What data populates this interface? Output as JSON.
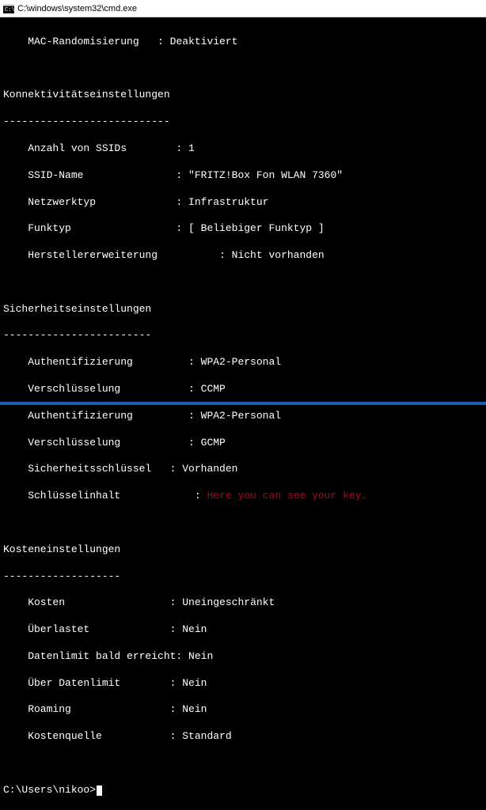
{
  "titlebar": {
    "title": "C:\\windows\\system32\\cmd.exe"
  },
  "top": {
    "macRandLabel": "    MAC-Randomisierung   : ",
    "macRandValue": "Deaktiviert"
  },
  "conn": {
    "header": "Konnektivitätseinstellungen",
    "dashes": "---------------------------",
    "ssidCountLabel": "    Anzahl von SSIDs        : ",
    "ssidCountValue": "1",
    "ssidNameLabel": "    SSID-Name               : ",
    "ssidNameValue": "\"FRITZ!Box Fon WLAN 7360\"",
    "netTypeLabel": "    Netzwerktyp             : ",
    "netTypeValue": "Infrastruktur",
    "radioTypeLabel": "    Funktyp                 : ",
    "radioTypeValue": "[ Beliebiger Funktyp ]",
    "vendorExtLabel": "    Herstellererweiterung          : ",
    "vendorExtValue": "Nicht vorhanden"
  },
  "sec": {
    "header": "Sicherheitseinstellungen",
    "dashes": "------------------------",
    "auth1Label": "    Authentifizierung         : ",
    "auth1Value": "WPA2-Personal",
    "enc1Label": "    Verschlüsselung           : ",
    "enc1Value": "CCMP",
    "auth2Label": "    Authentifizierung         : ",
    "auth2Value": "WPA2-Personal",
    "enc2Label": "    Verschlüsselung           : ",
    "enc2Value": "GCMP",
    "keyPresLabel": "    Sicherheitsschlüssel   : ",
    "keyPresValue": "Vorhanden",
    "keyContentLabel": "    Schlüsselinhalt            : ",
    "keyContentValue": "Here you can see your key."
  },
  "cost": {
    "header": "Kosteneinstellungen",
    "dashes": "-------------------",
    "costsLabel": "    Kosten                 : ",
    "costsValue": "Uneingeschränkt",
    "overLabel": "    Überlastet             : ",
    "overValue": "Nein",
    "nearLimitLabel": "    Datenlimit bald erreicht: ",
    "nearLimitValue": "Nein",
    "overLimitLabel": "    Über Datenlimit        : ",
    "overLimitValue": "Nein",
    "roamLabel": "    Roaming                : ",
    "roamValue": "Nein",
    "costSrcLabel": "    Kostenquelle           : ",
    "costSrcValue": "Standard"
  },
  "prompt": {
    "path": "C:\\Users\\nikoo>"
  }
}
